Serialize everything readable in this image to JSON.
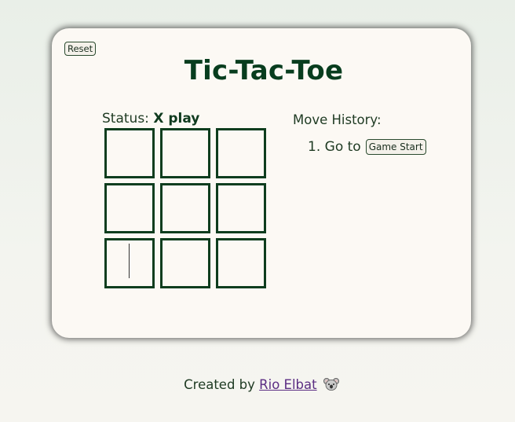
{
  "game": {
    "reset_label": "Reset",
    "title": "Tic-Tac-Toe",
    "status_label": "Status: ",
    "status_value": "X play",
    "board": [
      [
        "",
        "",
        ""
      ],
      [
        "",
        "",
        ""
      ],
      [
        "",
        "",
        ""
      ]
    ]
  },
  "history": {
    "title": "Move History:",
    "moves": [
      {
        "number": "1.",
        "prefix": "Go to",
        "button_label": "Game Start"
      }
    ]
  },
  "footer": {
    "prefix": "Created by ",
    "author": "Rio Elbat",
    "icon": "koala-icon"
  }
}
